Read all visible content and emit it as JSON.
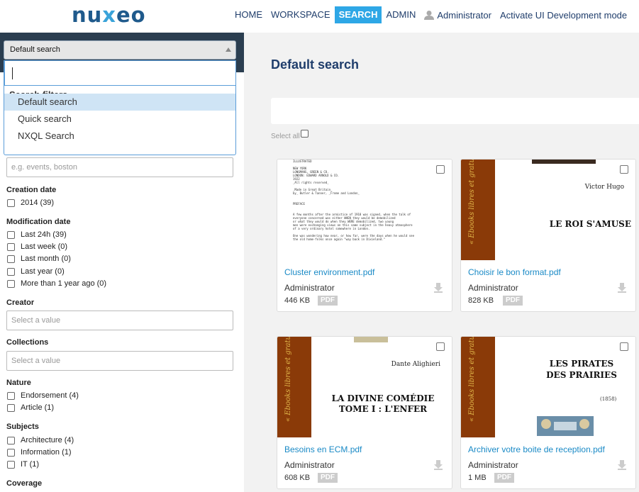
{
  "header": {
    "logo": {
      "pre": "nu",
      "x": "x",
      "post": "eo"
    },
    "nav": [
      "HOME",
      "WORKSPACE",
      "SEARCH",
      "ADMIN"
    ],
    "active_nav": "SEARCH",
    "user": "Administrator",
    "dev_mode": "Activate UI Development mode"
  },
  "sidebar": {
    "search_select": {
      "value": "Default search"
    },
    "dropdown": {
      "group": "Search filters",
      "options": [
        "Default search",
        "Quick search",
        "NXQL Search"
      ],
      "highlighted": "Default search"
    },
    "text_filter_placeholder": "e.g. events, boston",
    "creation_date": {
      "title": "Creation date",
      "items": [
        "2014 (39)"
      ]
    },
    "modification_date": {
      "title": "Modification date",
      "items": [
        "Last 24h (39)",
        "Last week (0)",
        "Last month (0)",
        "Last year (0)",
        "More than 1 year ago (0)"
      ]
    },
    "creator": {
      "title": "Creator",
      "placeholder": "Select a value"
    },
    "collections": {
      "title": "Collections",
      "placeholder": "Select a value"
    },
    "nature": {
      "title": "Nature",
      "items": [
        "Endorsement (4)",
        "Article (1)"
      ]
    },
    "subjects": {
      "title": "Subjects",
      "items": [
        "Architecture (4)",
        "Information (1)",
        "IT (1)"
      ]
    },
    "coverage": {
      "title": "Coverage"
    }
  },
  "main": {
    "title": "Default search",
    "select_all": "Select all",
    "cards": [
      {
        "title": "Cluster environment.pdf",
        "author": "Administrator",
        "size": "446 KB",
        "type": "PDF"
      },
      {
        "title": "Choisir le bon format.pdf",
        "author": "Administrator",
        "size": "828 KB",
        "type": "PDF"
      },
      {
        "title": "Besoins en ECM.pdf",
        "author": "Administrator",
        "size": "608 KB",
        "type": "PDF"
      },
      {
        "title": "Archiver votre boite de reception.pdf",
        "author": "Administrator",
        "size": "1 MB",
        "type": "PDF"
      }
    ],
    "thumbs": {
      "doc_text": "ILLUSTRATED\n\nNEW YORK\nLONGMANS, GREEN & CO.\nLONDON: EDWARD ARNOLD & CO.\n1922\n_All rights reserved_\n\n_Made in Great Britain_\nby_ Butler & Tanner, _Frome and London_\n\n\nPREFACE\n\n\nA few months after the armistice of 1918 was signed, when the talk of\neveryone concerned was either WHEN they would be demobilized\nor what they would do when they WERE demobilized, two young\nmen were exchanging views on this same subject in the heavy atmosphere\nof a very ordinary hotel somewhere in London.\n\nOne was wondering how near, or how far, were the days when he would see\nthe old home-folks once again \"way back in Dixieland.\"",
      "spine": "« Ebooks libres et gratuits »",
      "book1": {
        "author": "Victor Hugo",
        "title": "LE ROI S'AMUSE"
      },
      "book2": {
        "author": "Dante Alighieri",
        "title_line1": "LA DIVINE COMÉDIE",
        "title_line2": "TOME I : L'ENFER"
      },
      "book3": {
        "title_line1": "LES PIRATES",
        "title_line2": "DES PRAIRIES",
        "year": "(1858)"
      }
    }
  }
}
